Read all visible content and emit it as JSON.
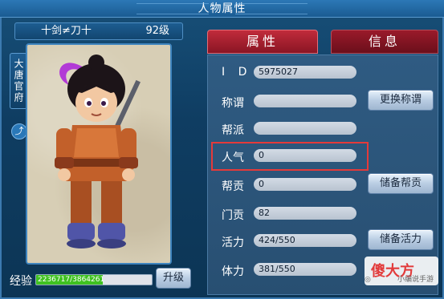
{
  "window": {
    "title": "人物属性"
  },
  "character": {
    "name": "十剑≠刀十",
    "level": "92级",
    "side_tab": "大唐官府",
    "share_icon": "share-icon",
    "exp_label": "经验",
    "exp_text": "2236717/3864261",
    "exp_current": 2236717,
    "exp_max": 3864261,
    "upgrade_label": "升级"
  },
  "tabs": [
    {
      "label": "属性",
      "active": true
    },
    {
      "label": "信息",
      "active": false
    }
  ],
  "info": {
    "rows": [
      {
        "label": "I D",
        "value": "5975027"
      },
      {
        "label": "称谓",
        "value": ""
      },
      {
        "label": "帮派",
        "value": ""
      },
      {
        "label": "人气",
        "value": "0"
      },
      {
        "label": "帮贡",
        "value": "0"
      },
      {
        "label": "门贡",
        "value": "82"
      },
      {
        "label": "活力",
        "value": "424/550"
      },
      {
        "label": "体力",
        "value": "381/550"
      }
    ],
    "buttons": {
      "change_title": "更换称谓",
      "reserve_guild": "储备帮贡",
      "reserve_vitality": "储备活力"
    }
  },
  "watermark": {
    "logo": "傻大方",
    "sub": "小编说手游"
  },
  "colors": {
    "tab_active": "#c12b3b",
    "tab_inactive": "#7a1320",
    "highlight": "#e53a3a",
    "exp_fill": "#3fc220"
  }
}
